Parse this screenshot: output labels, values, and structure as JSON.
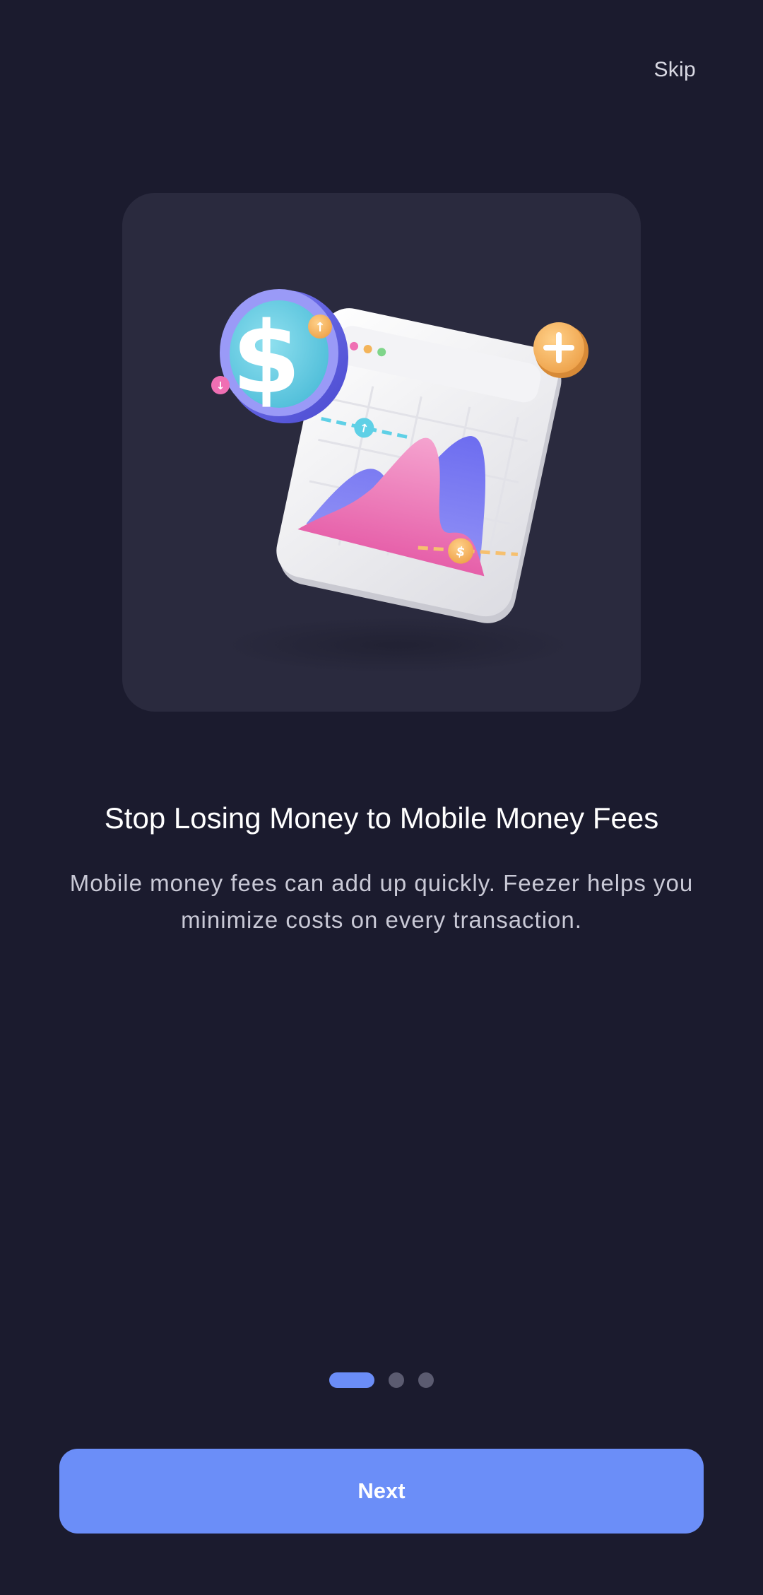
{
  "header": {
    "skip_label": "Skip"
  },
  "illustration": {
    "icon": "finance-chart-coin-illustration",
    "coin_symbol": "$",
    "chart_badge_symbol": "$"
  },
  "onboarding": {
    "title": "Stop Losing Money to Mobile Money Fees",
    "description": "Mobile money fees can add up quickly. Feezer helps you minimize costs on every transaction."
  },
  "pager": {
    "total": 3,
    "active_index": 0
  },
  "footer": {
    "next_label": "Next"
  },
  "colors": {
    "background": "#1b1b2e",
    "card": "#2a2a3e",
    "accent": "#6b8ef8",
    "dot_inactive": "#5b5b70"
  }
}
